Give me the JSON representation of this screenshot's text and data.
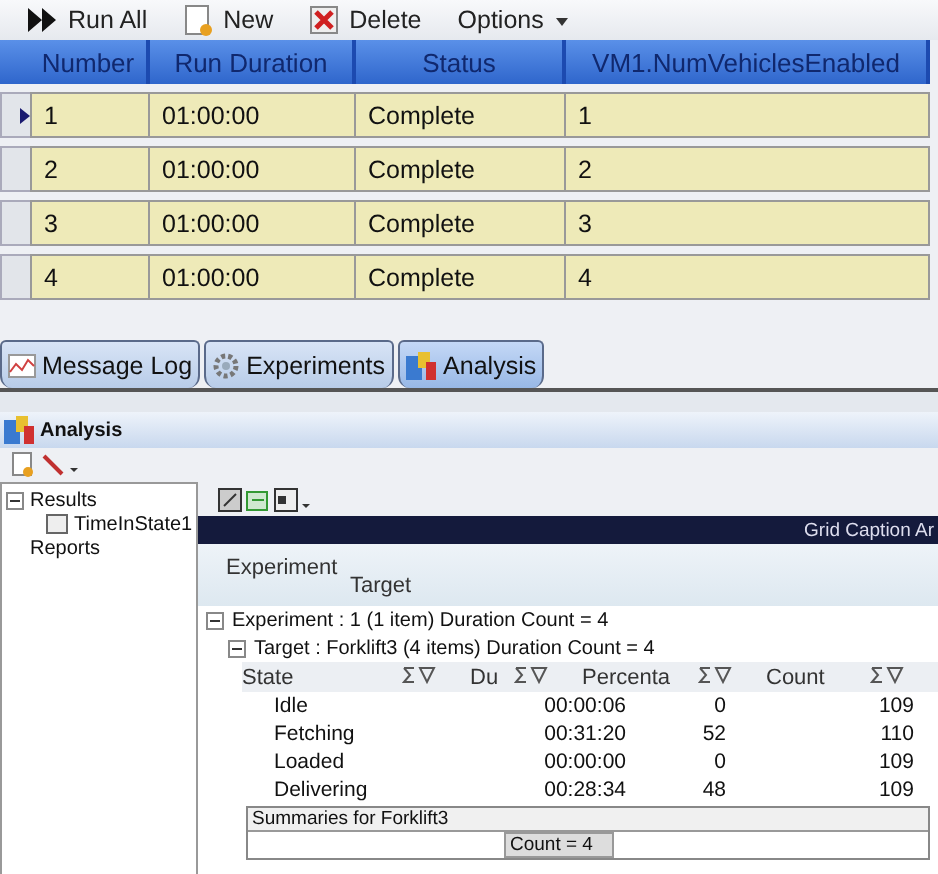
{
  "toolbar": {
    "items": [
      {
        "label": "Run All"
      },
      {
        "label": "New"
      },
      {
        "label": "Delete"
      },
      {
        "label": "Options"
      }
    ]
  },
  "experiment_table": {
    "columns": [
      "Number",
      "Run Duration",
      "Status",
      "VM1.NumVehiclesEnabled"
    ],
    "rows": [
      {
        "cells": [
          "1",
          "01:00:00",
          "Complete",
          "1"
        ],
        "selected": true
      },
      {
        "cells": [
          "2",
          "01:00:00",
          "Complete",
          "2"
        ],
        "selected": false
      },
      {
        "cells": [
          "3",
          "01:00:00",
          "Complete",
          "3"
        ],
        "selected": false
      },
      {
        "cells": [
          "4",
          "01:00:00",
          "Complete",
          "4"
        ],
        "selected": false
      }
    ]
  },
  "tabs": [
    {
      "label": "Message Log",
      "selected": false
    },
    {
      "label": "Experiments",
      "selected": false
    },
    {
      "label": "Analysis",
      "selected": true
    }
  ],
  "analysis": {
    "title": "Analysis",
    "tree": [
      {
        "label": "Results",
        "expanded": true,
        "children": [
          {
            "label": "TimeInState1"
          }
        ]
      },
      {
        "label": "Reports"
      }
    ],
    "caption": "Grid Caption Ar",
    "group_by": [
      "Experiment",
      "Target"
    ],
    "groups": [
      {
        "label": "Experiment : 1 (1 item) Duration Count = 4",
        "expanded": true
      },
      {
        "label": "Target : Forklift3 (4 items) Duration Count = 4",
        "expanded": true
      }
    ],
    "columns": [
      "State",
      "Du",
      "Percenta",
      "Count"
    ],
    "rows": [
      {
        "cells": [
          "Idle",
          "00:00:06",
          "0",
          "109"
        ]
      },
      {
        "cells": [
          "Fetching",
          "00:31:20",
          "52",
          "110"
        ]
      },
      {
        "cells": [
          "Loaded",
          "00:00:00",
          "0",
          "109"
        ]
      },
      {
        "cells": [
          "Delivering",
          "00:28:34",
          "48",
          "109"
        ]
      }
    ],
    "summary": {
      "title": "Summaries for Forklift3",
      "value": "Count = 4"
    }
  }
}
